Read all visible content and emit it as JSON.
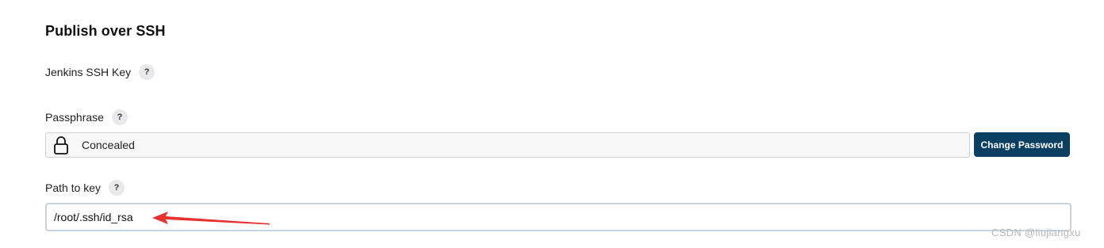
{
  "section": {
    "title": "Publish over SSH"
  },
  "fields": {
    "ssh_key": {
      "label": "Jenkins SSH Key",
      "help": "?"
    },
    "passphrase": {
      "label": "Passphrase",
      "help": "?",
      "value_text": "Concealed",
      "button_label": "Change Password"
    },
    "path_to_key": {
      "label": "Path to key",
      "help": "?",
      "value": "/root/.ssh/id_rsa"
    }
  },
  "annotation": {
    "arrow_color": "#e8312f"
  },
  "watermark": {
    "text": "CSDN @liujiangxu"
  },
  "colors": {
    "primary_button": "#0b3f61",
    "help_bg": "#e9e9ec",
    "concealed_bg": "#f8f8f8"
  },
  "icons": {
    "lock": "lock-icon",
    "help": "help-icon"
  }
}
